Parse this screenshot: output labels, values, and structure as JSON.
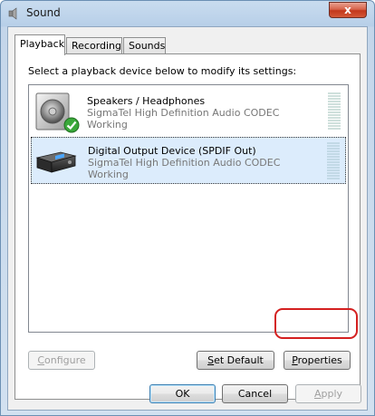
{
  "window": {
    "title": "Sound",
    "close_glyph": "x"
  },
  "tabs": [
    {
      "label": "Playback",
      "active": true
    },
    {
      "label": "Recording",
      "active": false
    },
    {
      "label": "Sounds",
      "active": false
    }
  ],
  "instruction": "Select a playback device below to modify its settings:",
  "devices": [
    {
      "name": "Speakers / Headphones",
      "driver": "SigmaTel High Definition Audio CODEC",
      "status": "Working",
      "icon": "speaker-icon",
      "default_badge": "check-icon",
      "selected": false
    },
    {
      "name": "Digital Output Device (SPDIF Out)",
      "driver": "SigmaTel High Definition Audio CODEC",
      "status": "Working",
      "icon": "digital-output-icon",
      "selected": true
    }
  ],
  "buttons": {
    "configure": {
      "label": "Configure",
      "accel": "C",
      "rest": "onfigure",
      "enabled": false
    },
    "set_default": {
      "label": "Set Default",
      "accel": "S",
      "rest": "et Default",
      "enabled": true
    },
    "properties": {
      "label": "Properties",
      "accel": "P",
      "rest": "roperties",
      "enabled": true,
      "highlighted": true
    },
    "ok": {
      "label": "OK",
      "enabled": true
    },
    "cancel": {
      "label": "Cancel",
      "enabled": true
    },
    "apply": {
      "label": "Apply",
      "accel": "A",
      "rest": "pply",
      "enabled": false
    }
  },
  "colors": {
    "accent": "#3c7fb1",
    "selection": "#dcecfc",
    "highlight_ring": "#d42020",
    "check_green": "#3aa83a"
  }
}
